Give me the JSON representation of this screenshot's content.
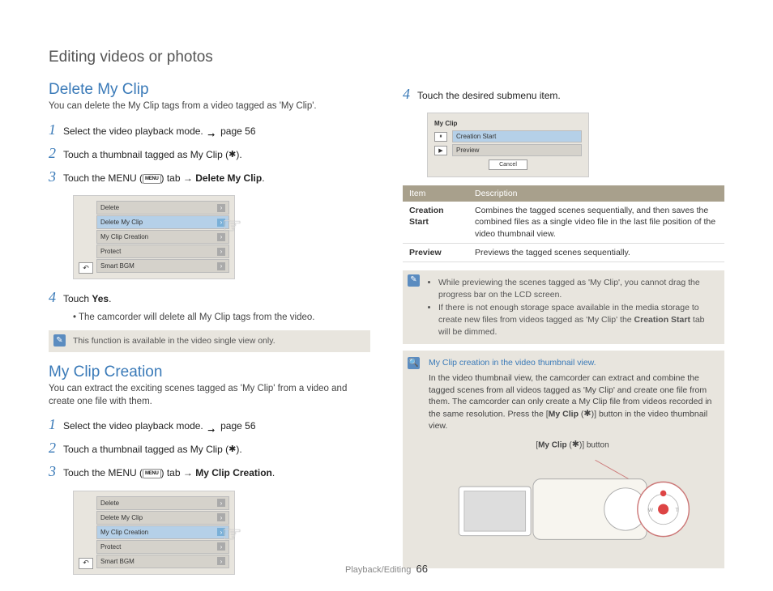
{
  "page_title": "Editing videos or photos",
  "footer_section": "Playback/Editing",
  "page_number": "66",
  "delete": {
    "title": "Delete My Clip",
    "intro": "You can delete the My Clip tags from a video tagged as 'My Clip'.",
    "step1": "Select the video playback mode.",
    "step1_ref": "page 56",
    "step2_a": "Touch a thumbnail tagged as My Clip (",
    "step2_b": ").",
    "step3_a": "Touch the MENU (",
    "step3_b": ") tab → ",
    "step3_bold": "Delete My Clip",
    "step4_a": "Touch ",
    "step4_bold": "Yes",
    "step4_b": ".",
    "bullet": "The camcorder will delete all My Clip tags from the video.",
    "note": "This function is available in the video single view only."
  },
  "menu_items": {
    "m1": "Delete",
    "m2": "Delete My Clip",
    "m3": "My Clip Creation",
    "m4": "Protect",
    "m5": "Smart BGM"
  },
  "creation": {
    "title": "My Clip Creation",
    "intro": "You can extract the exciting scenes tagged as 'My Clip' from a video and create one file with them.",
    "step1": "Select the video playback mode.",
    "step1_ref": "page 56",
    "step2_a": "Touch a thumbnail tagged as My Clip (",
    "step2_b": ").",
    "step3_a": "Touch the MENU (",
    "step3_b": ") tab → ",
    "step3_bold": "My Clip Creation",
    "step4": "Touch the desired submenu item."
  },
  "submenu": {
    "title": "My Clip",
    "row1": "Creation Start",
    "row2": "Preview",
    "cancel": "Cancel"
  },
  "table": {
    "h1": "Item",
    "h2": "Description",
    "r1c1": "Creation Start",
    "r1c2": "Combines the tagged scenes sequentially, and then saves the combined files as a single video file in the last file position of the video thumbnail view.",
    "r2c1": "Preview",
    "r2c2": "Previews the tagged scenes sequentially."
  },
  "note2": {
    "b1": "While previewing the scenes tagged as 'My Clip', you cannot drag the progress bar on the LCD screen.",
    "b2_a": "If there is not enough storage space available in the media storage to create new files from videos tagged as 'My Clip' the ",
    "b2_bold": "Creation Start",
    "b2_b": " tab will be dimmed."
  },
  "tip": {
    "title": "My Clip creation in the video thumbnail view.",
    "body_a": "In the video thumbnail view, the camcorder can extract and combine the tagged scenes from all videos tagged as 'My Clip' and create one file from them. The camcorder can only create a My Clip file from videos recorded in the same resolution. Press the [",
    "body_bold": "My Clip",
    "body_b": " (",
    "body_c": ")] button in the video thumbnail view.",
    "label_a": "[",
    "label_bold": "My Clip",
    "label_b": " (",
    "label_c": ")] button"
  },
  "icons": {
    "menu_label": "MENU"
  }
}
